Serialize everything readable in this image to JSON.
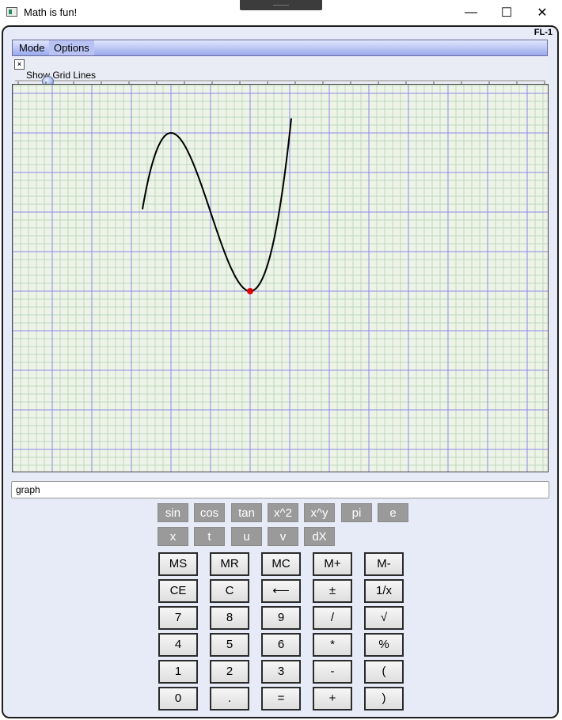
{
  "window": {
    "title": "Math is fun!",
    "badge": "FL-1"
  },
  "title_controls": {
    "minimize": "—",
    "maximize": "☐",
    "close": "✕"
  },
  "menu": {
    "items": [
      "Mode",
      "Options"
    ]
  },
  "options_bar": {
    "close_glyph": "×",
    "grid_label": "Show Grid Lines",
    "grid_lines_slider": 0.06
  },
  "graph": {
    "curve_color": "#000000",
    "point_color": "#e00000",
    "major_grid_color": "#8a8ae8",
    "minor_grid_color": "#bcd8bc",
    "background": "#eef3e8"
  },
  "expression": {
    "value": "graph"
  },
  "function_buttons": {
    "row1": [
      "sin",
      "cos",
      "tan",
      "x^2",
      "x^y",
      "pi",
      "e"
    ],
    "row2": [
      "x",
      "t",
      "u",
      "v",
      "dX"
    ]
  },
  "keypad": {
    "rows": [
      [
        "MS",
        "MR",
        "MC",
        "M+",
        "M-"
      ],
      [
        "CE",
        "C",
        "⟵",
        "±",
        "1/x"
      ],
      [
        "7",
        "8",
        "9",
        "/",
        "√"
      ],
      [
        "4",
        "5",
        "6",
        "*",
        "%"
      ],
      [
        "1",
        "2",
        "3",
        "-",
        "("
      ],
      [
        "0",
        ".",
        "=",
        "+",
        ")"
      ]
    ]
  }
}
